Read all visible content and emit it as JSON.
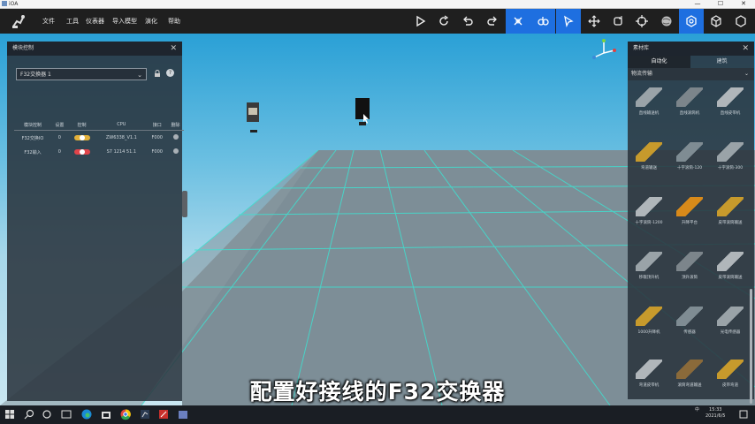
{
  "window": {
    "title": "iOA",
    "minimize": "—",
    "maximize": "☐",
    "close": "✕"
  },
  "menu": {
    "items": [
      "文件",
      "工具",
      "仪表器",
      "导入模型",
      "演化",
      "帮助"
    ]
  },
  "toolbar_icons": [
    "play-icon",
    "refresh-icon",
    "undo-icon",
    "redo-icon",
    "select-region-icon",
    "robot-icon",
    "pointer-icon",
    "move-icon",
    "rotate-icon",
    "target-icon",
    "globe-icon",
    "settings-icon",
    "cube-icon",
    "box-icon"
  ],
  "left_panel": {
    "title": "模块控制",
    "select_value": "F32交换器 1",
    "table": {
      "headers": [
        "模块控制",
        "设置",
        "控制",
        "CPU",
        "接口",
        "删除"
      ],
      "rows": [
        {
          "name": "F32交换IO",
          "setting": "0",
          "toggle_color": "#e3b13a",
          "cpu": "ZW6338_V1.1",
          "port": "F000"
        },
        {
          "name": "F32输入",
          "setting": "0",
          "toggle_color": "#e0444a",
          "cpu": "S7 1214 51.1",
          "port": "F000"
        }
      ]
    }
  },
  "right_panel": {
    "title": "素材库",
    "tabs": [
      "自动化",
      "建筑"
    ],
    "category": "物流传输",
    "items": [
      "直线输送机",
      "直线滚筒机",
      "直线皮带机",
      "弯道输送",
      "十字滚筒-120",
      "十字滚筒-300",
      "十字滚筒-1200",
      "升降平台",
      "皮带滚筒输送",
      "移栽顶升机",
      "顶升滚筒",
      "皮带滚筒输送",
      "1000升降机",
      "传感器",
      "光电传感器",
      "弯道皮带机",
      "滚筒弯道输送",
      "皮带弯道"
    ]
  },
  "subtitle": "配置好接线的F32交换器",
  "taskbar": {
    "time": "15:33",
    "date": "2021/6/5",
    "lang": "中",
    "tray_text": "ENG"
  },
  "colors": {
    "accent": "#1e6fe0",
    "grid": "#3fe0d0"
  }
}
